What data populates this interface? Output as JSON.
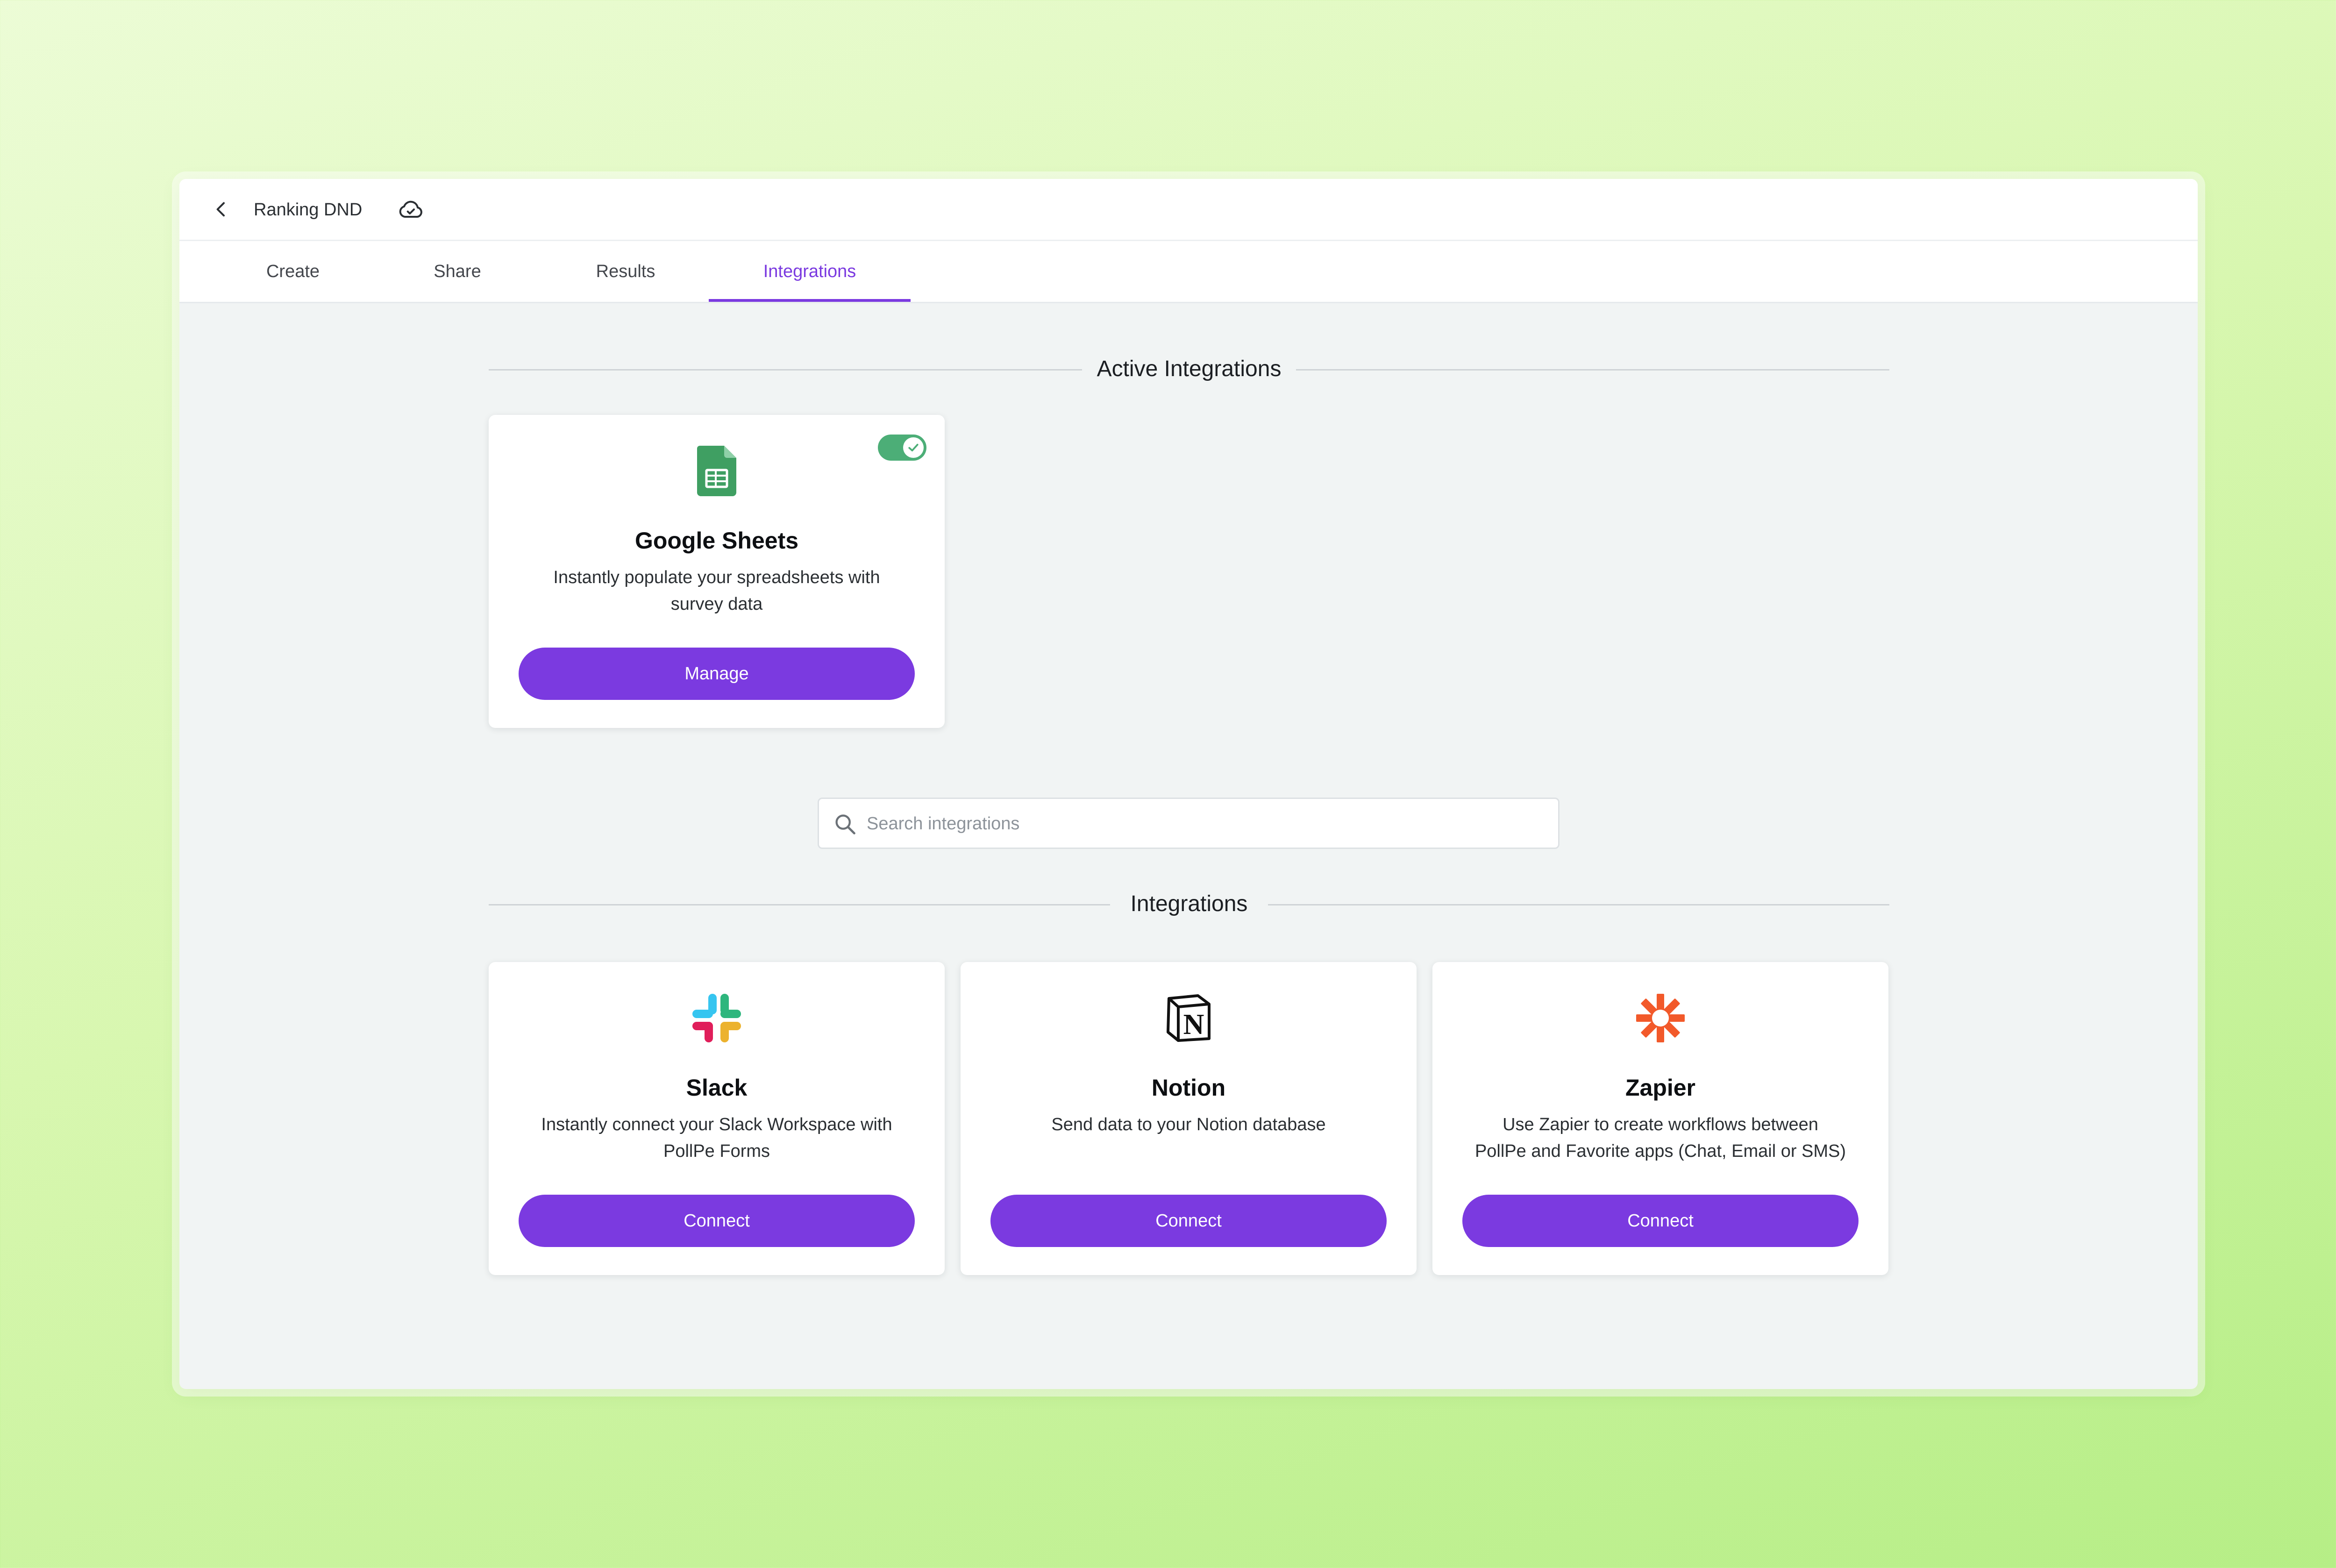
{
  "header": {
    "form_title": "Ranking DND",
    "back_icon": "chevron-left-icon",
    "sync_icon": "cloud-check-icon"
  },
  "tabs": [
    {
      "label": "Create",
      "active": false
    },
    {
      "label": "Share",
      "active": false
    },
    {
      "label": "Results",
      "active": false
    },
    {
      "label": "Integrations",
      "active": true
    }
  ],
  "active_section": {
    "title": "Active Integrations",
    "cards": [
      {
        "name": "Google Sheets",
        "description": "Instantly populate your spreadsheets with survey data",
        "button_label": "Manage",
        "icon": "google-sheets-icon",
        "enabled": true
      }
    ]
  },
  "search": {
    "placeholder": "Search integrations",
    "value": ""
  },
  "integrations_section": {
    "title": "Integrations",
    "cards": [
      {
        "name": "Slack",
        "description": "Instantly connect your Slack Workspace with PollPe Forms",
        "button_label": "Connect",
        "icon": "slack-icon"
      },
      {
        "name": "Notion",
        "description": "Send data to your Notion database",
        "button_label": "Connect",
        "icon": "notion-icon"
      },
      {
        "name": "Zapier",
        "description": "Use Zapier to create workflows between PollPe and Favorite apps (Chat, Email or SMS)",
        "button_label": "Connect",
        "icon": "zapier-icon"
      }
    ]
  },
  "colors": {
    "accent": "#7b3ae0",
    "toggle_on": "#4cae77",
    "sheets_green": "#3f9f62",
    "zapier_orange": "#f2592a"
  }
}
